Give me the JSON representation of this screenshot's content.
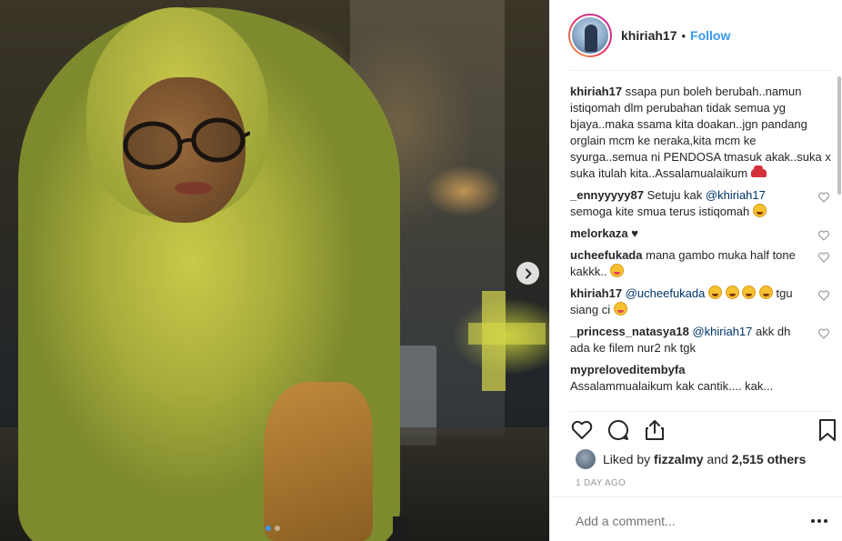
{
  "post": {
    "username": "khiriah17",
    "bullet": "•",
    "follow_label": "Follow",
    "caption": {
      "username": "khiriah17",
      "text": "ssapa pun boleh berubah..namun istiqomah dlm perubahan tidak semua yg bjaya..maka ssama kita doakan..jgn pandang orglain mcm ke neraka,kita mcm ke syurga..semua ni PENDOSA tmasuk akak..suka x suka itulah kita..Assalamualaikum"
    },
    "comments": [
      {
        "username": "_ennyyyyy87",
        "mention": "",
        "text": "Setuju kak ",
        "mention2": "@khiriah17",
        "text2": "semoga kite smua terus istiqomah"
      },
      {
        "username": "melorkaza",
        "text": "♥"
      },
      {
        "username": "ucheefukada",
        "text": "mana gambo muka half tone kakkk.."
      },
      {
        "username": "khiriah17",
        "mention": "@ucheefukada",
        "text": "tgu siang ci"
      },
      {
        "username": "_princess_natasya18",
        "mention": "@khiriah17",
        "text": "akk dh ada ke filem nur2 nk tgk"
      },
      {
        "username": "mypreloveditembyfa",
        "text": "Assalammualaikum kak cantik.... kak..."
      }
    ],
    "likes": {
      "prefix": "Liked by",
      "user": "fizzalmy",
      "connector": "and",
      "others": "2,515 others"
    },
    "timestamp": "1 DAY AGO",
    "add_comment_placeholder": "Add a comment..."
  },
  "icons": [
    "heart-icon",
    "comment-icon",
    "share-icon",
    "bookmark-icon",
    "chevron-right-icon",
    "more-icon"
  ],
  "colors": {
    "link": "#3897f0",
    "mention": "#003569",
    "muted": "#999999",
    "text": "#262626"
  }
}
